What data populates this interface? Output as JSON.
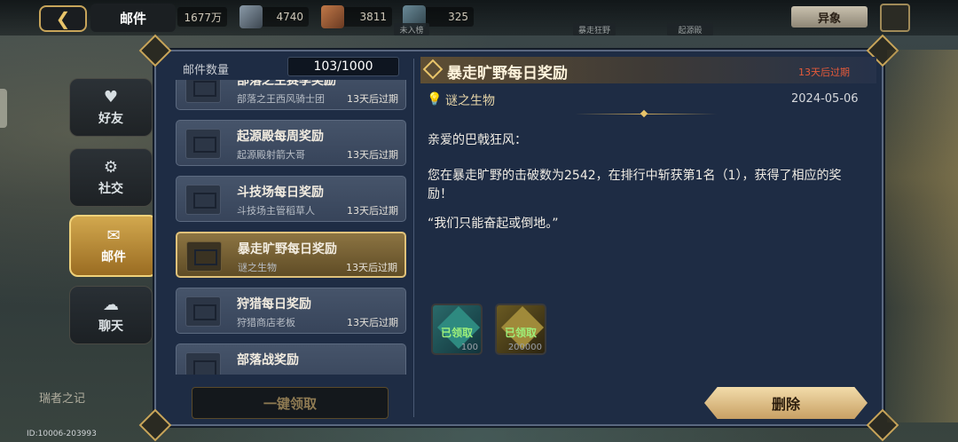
{
  "header": {
    "title": "邮件",
    "resources": [
      "1677万",
      "4740",
      "3811",
      "325"
    ],
    "right_button": "异象",
    "chips": [
      "未入榜",
      "暴走狂野",
      "起源殿"
    ]
  },
  "sidebar": {
    "items": [
      {
        "label": "好友",
        "icon": "♥"
      },
      {
        "label": "社交",
        "icon": "⚙"
      },
      {
        "label": "邮件",
        "icon": "✉"
      },
      {
        "label": "聊天",
        "icon": "☁"
      }
    ]
  },
  "mail_list": {
    "count_label": "邮件数量",
    "count_value": "103/1000",
    "items": [
      {
        "title": "部落之主赛季奖励",
        "sender": "部落之王西风骑士团",
        "expiry": "13天后过期"
      },
      {
        "title": "起源殿每周奖励",
        "sender": "起源殿射箭大哥",
        "expiry": "13天后过期"
      },
      {
        "title": "斗技场每日奖励",
        "sender": "斗技场主管稻草人",
        "expiry": "13天后过期"
      },
      {
        "title": "暴走旷野每日奖励",
        "sender": "谜之生物",
        "expiry": "13天后过期"
      },
      {
        "title": "狩猎每日奖励",
        "sender": "狩猎商店老板",
        "expiry": "13天后过期"
      },
      {
        "title": "部落战奖励",
        "sender": "",
        "expiry": ""
      }
    ],
    "claim_all": "一键领取"
  },
  "detail": {
    "title": "暴走旷野每日奖励",
    "expiry": "13天后过期",
    "sender": "谜之生物",
    "date": "2024-05-06",
    "greeting": "亲爱的巴戟狂风：",
    "paragraph": "您在暴走旷野的击破数为2542，在排行中斩获第1名（1），获得了相应的奖励！",
    "quote": "“我们只能奋起或倒地。”",
    "rewards": [
      {
        "status": "已领取",
        "qty": "100"
      },
      {
        "status": "已领取",
        "qty": "200000"
      }
    ],
    "delete": "删除"
  },
  "footer": {
    "left_label": "瑞者之记",
    "user_id": "ID:10006-203993"
  },
  "colors": {
    "panel": "#1e2c44",
    "accent_gold": "#e8c46a",
    "expiry_red": "#e65a3a",
    "claimed_green": "#9ef07a"
  }
}
